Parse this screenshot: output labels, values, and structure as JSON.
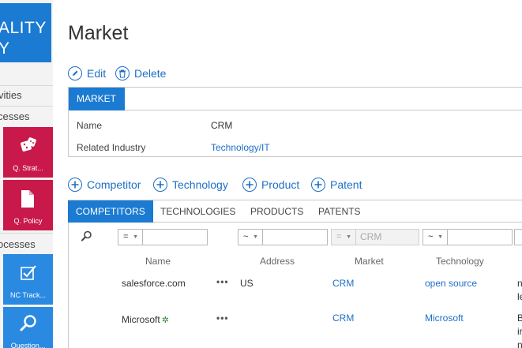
{
  "sidebar": {
    "brand_line1": "ALITY",
    "brand_line2": "Y",
    "activities_label": "vities",
    "processes_label": "cesses",
    "processes2_label": "ocesses",
    "tiles": [
      {
        "label": "Q. Strat...",
        "icon": "dice-icon",
        "color": "#c8194a"
      },
      {
        "label": "Q. Policy",
        "icon": "document-icon",
        "color": "#c8194a"
      },
      {
        "label": "NC Track...",
        "icon": "checkbox-icon",
        "color": "#2a8ae2"
      },
      {
        "label": "Question...",
        "icon": "search-icon",
        "color": "#2a8ae2"
      }
    ]
  },
  "page": {
    "title": "Market"
  },
  "commands": {
    "edit": "Edit",
    "delete": "Delete"
  },
  "market_panel": {
    "tab": "MARKET",
    "fields": [
      {
        "label": "Name",
        "value": "CRM"
      },
      {
        "label": "Related Industry",
        "value": "Technology/IT"
      }
    ]
  },
  "add_actions": [
    "Competitor",
    "Technology",
    "Product",
    "Patent"
  ],
  "tabs": [
    "COMPETITORS",
    "TECHNOLOGIES",
    "PRODUCTS",
    "PATENTS"
  ],
  "grid": {
    "filters": [
      {
        "op": "=",
        "value": ""
      },
      {
        "op": "~",
        "value": ""
      },
      {
        "op": "=",
        "value": "CRM"
      },
      {
        "op": "~",
        "value": ""
      }
    ],
    "columns": [
      "Name",
      "Address",
      "Market",
      "Technology"
    ],
    "rows": [
      {
        "name": "salesforce.com",
        "address": "US",
        "market": "CRM",
        "technology": "open source",
        "extra1": "n",
        "extra2": "le"
      },
      {
        "name": "Microsoft",
        "address": "",
        "market": "CRM",
        "technology": "Microsoft",
        "extra1": "B",
        "extra2": "ir"
      }
    ],
    "row3_extra": "n"
  },
  "colors": {
    "accent": "#1b7bd2",
    "link": "#1d6fc6",
    "tile_red": "#c8194a",
    "tile_blue": "#2a8ae2"
  }
}
